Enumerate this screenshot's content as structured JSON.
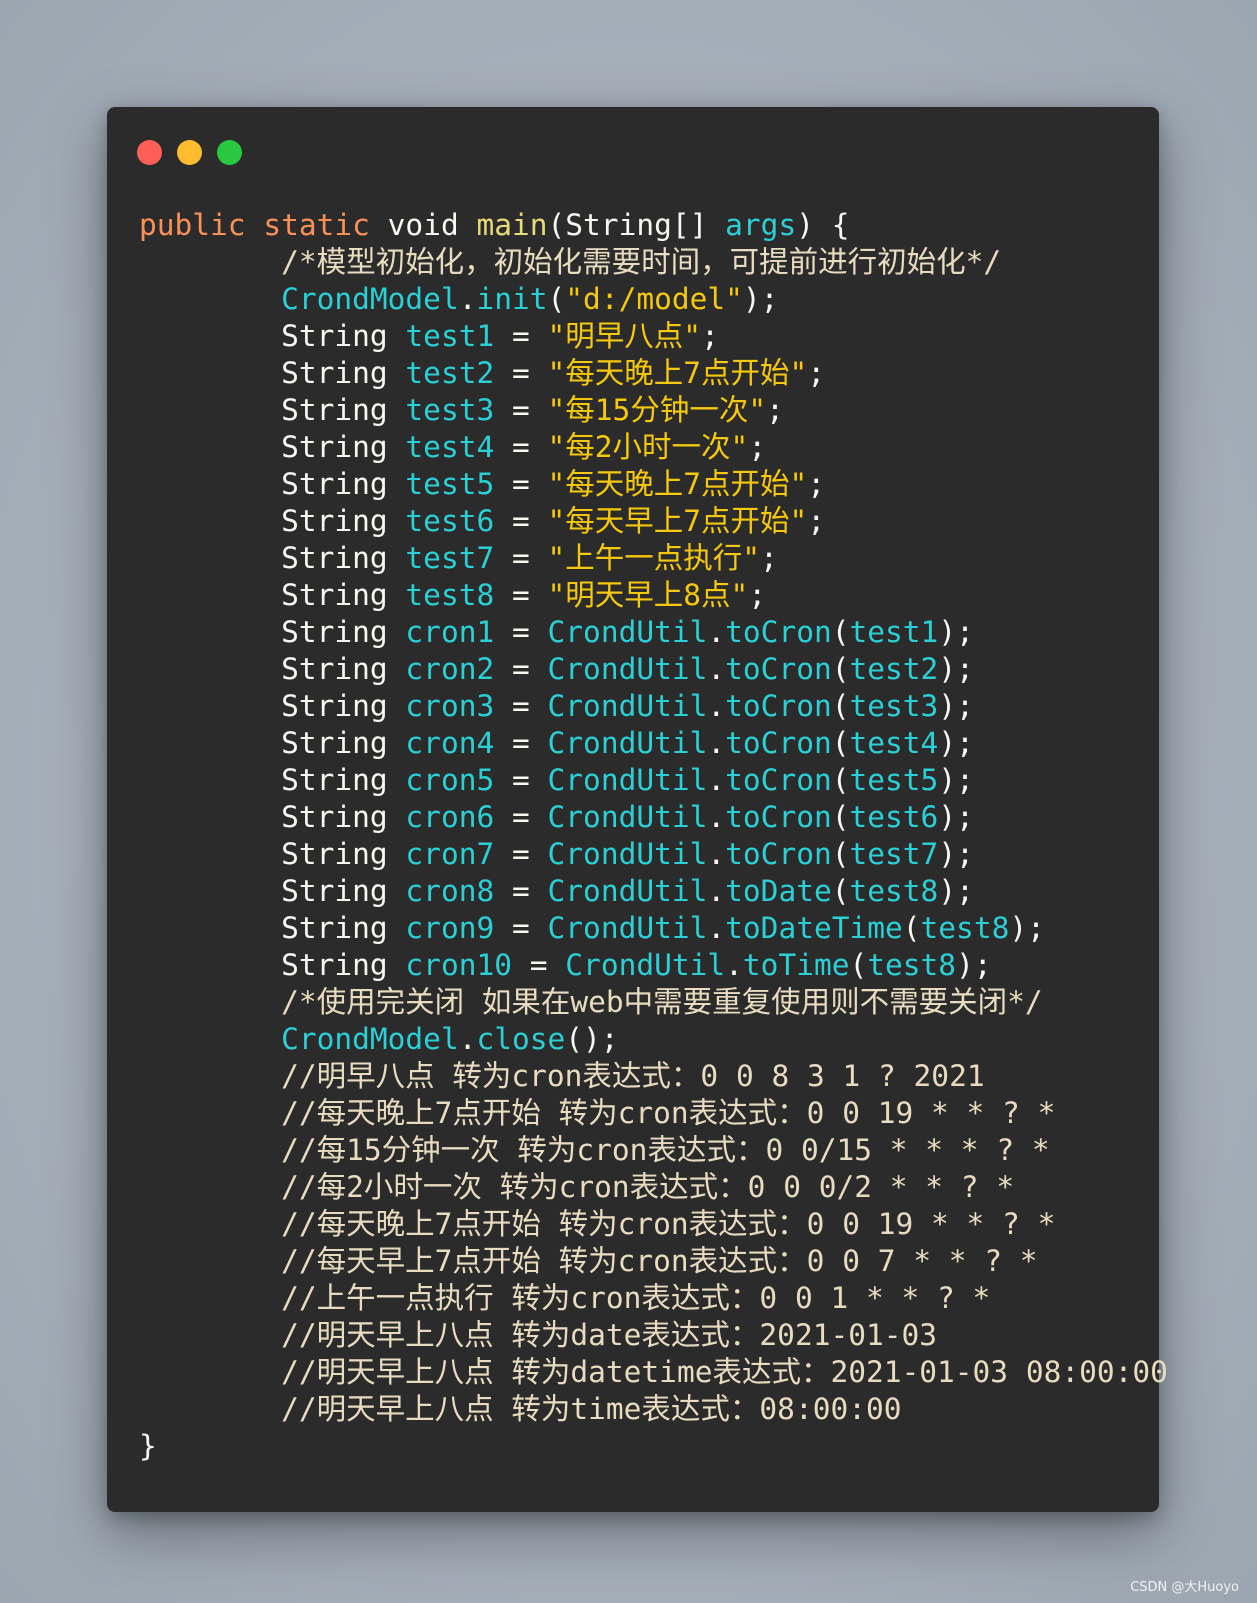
{
  "window": {
    "controls": [
      {
        "name": "close",
        "color": "#ff5f57"
      },
      {
        "name": "minimize",
        "color": "#febc2e"
      },
      {
        "name": "maximize",
        "color": "#28c840"
      }
    ]
  },
  "code_lines": [
    [
      [
        "keyword",
        "public "
      ],
      [
        "keyword",
        "static "
      ],
      [
        "default",
        "void "
      ],
      [
        "func",
        "main"
      ],
      [
        "punct",
        "("
      ],
      [
        "default",
        "String"
      ],
      [
        "punct",
        "[] "
      ],
      [
        "var",
        "args"
      ],
      [
        "punct",
        ") {"
      ]
    ],
    [
      [
        "default",
        "        "
      ],
      [
        "comment",
        "/*模型初始化，初始化需要时间，可提前进行初始化*/"
      ]
    ],
    [
      [
        "default",
        "        "
      ],
      [
        "var",
        "CrondModel"
      ],
      [
        "punct",
        "."
      ],
      [
        "var",
        "init"
      ],
      [
        "punct",
        "("
      ],
      [
        "string",
        "\"d:/model\""
      ],
      [
        "punct",
        ");"
      ]
    ],
    [
      [
        "default",
        "        String "
      ],
      [
        "var",
        "test1"
      ],
      [
        "punct",
        " = "
      ],
      [
        "string",
        "\"明早八点\""
      ],
      [
        "punct",
        ";"
      ]
    ],
    [
      [
        "default",
        "        String "
      ],
      [
        "var",
        "test2"
      ],
      [
        "punct",
        " = "
      ],
      [
        "string",
        "\"每天晚上7点开始\""
      ],
      [
        "punct",
        ";"
      ]
    ],
    [
      [
        "default",
        "        String "
      ],
      [
        "var",
        "test3"
      ],
      [
        "punct",
        " = "
      ],
      [
        "string",
        "\"每15分钟一次\""
      ],
      [
        "punct",
        ";"
      ]
    ],
    [
      [
        "default",
        "        String "
      ],
      [
        "var",
        "test4"
      ],
      [
        "punct",
        " = "
      ],
      [
        "string",
        "\"每2小时一次\""
      ],
      [
        "punct",
        ";"
      ]
    ],
    [
      [
        "default",
        "        String "
      ],
      [
        "var",
        "test5"
      ],
      [
        "punct",
        " = "
      ],
      [
        "string",
        "\"每天晚上7点开始\""
      ],
      [
        "punct",
        ";"
      ]
    ],
    [
      [
        "default",
        "        String "
      ],
      [
        "var",
        "test6"
      ],
      [
        "punct",
        " = "
      ],
      [
        "string",
        "\"每天早上7点开始\""
      ],
      [
        "punct",
        ";"
      ]
    ],
    [
      [
        "default",
        "        String "
      ],
      [
        "var",
        "test7"
      ],
      [
        "punct",
        " = "
      ],
      [
        "string",
        "\"上午一点执行\""
      ],
      [
        "punct",
        ";"
      ]
    ],
    [
      [
        "default",
        "        String "
      ],
      [
        "var",
        "test8"
      ],
      [
        "punct",
        " = "
      ],
      [
        "string",
        "\"明天早上8点\""
      ],
      [
        "punct",
        ";"
      ]
    ],
    [
      [
        "default",
        "        String "
      ],
      [
        "var",
        "cron1"
      ],
      [
        "punct",
        " = "
      ],
      [
        "var",
        "CrondUtil"
      ],
      [
        "punct",
        "."
      ],
      [
        "var",
        "toCron"
      ],
      [
        "punct",
        "("
      ],
      [
        "var",
        "test1"
      ],
      [
        "punct",
        ");"
      ]
    ],
    [
      [
        "default",
        "        String "
      ],
      [
        "var",
        "cron2"
      ],
      [
        "punct",
        " = "
      ],
      [
        "var",
        "CrondUtil"
      ],
      [
        "punct",
        "."
      ],
      [
        "var",
        "toCron"
      ],
      [
        "punct",
        "("
      ],
      [
        "var",
        "test2"
      ],
      [
        "punct",
        ");"
      ]
    ],
    [
      [
        "default",
        "        String "
      ],
      [
        "var",
        "cron3"
      ],
      [
        "punct",
        " = "
      ],
      [
        "var",
        "CrondUtil"
      ],
      [
        "punct",
        "."
      ],
      [
        "var",
        "toCron"
      ],
      [
        "punct",
        "("
      ],
      [
        "var",
        "test3"
      ],
      [
        "punct",
        ");"
      ]
    ],
    [
      [
        "default",
        "        String "
      ],
      [
        "var",
        "cron4"
      ],
      [
        "punct",
        " = "
      ],
      [
        "var",
        "CrondUtil"
      ],
      [
        "punct",
        "."
      ],
      [
        "var",
        "toCron"
      ],
      [
        "punct",
        "("
      ],
      [
        "var",
        "test4"
      ],
      [
        "punct",
        ");"
      ]
    ],
    [
      [
        "default",
        "        String "
      ],
      [
        "var",
        "cron5"
      ],
      [
        "punct",
        " = "
      ],
      [
        "var",
        "CrondUtil"
      ],
      [
        "punct",
        "."
      ],
      [
        "var",
        "toCron"
      ],
      [
        "punct",
        "("
      ],
      [
        "var",
        "test5"
      ],
      [
        "punct",
        ");"
      ]
    ],
    [
      [
        "default",
        "        String "
      ],
      [
        "var",
        "cron6"
      ],
      [
        "punct",
        " = "
      ],
      [
        "var",
        "CrondUtil"
      ],
      [
        "punct",
        "."
      ],
      [
        "var",
        "toCron"
      ],
      [
        "punct",
        "("
      ],
      [
        "var",
        "test6"
      ],
      [
        "punct",
        ");"
      ]
    ],
    [
      [
        "default",
        "        String "
      ],
      [
        "var",
        "cron7"
      ],
      [
        "punct",
        " = "
      ],
      [
        "var",
        "CrondUtil"
      ],
      [
        "punct",
        "."
      ],
      [
        "var",
        "toCron"
      ],
      [
        "punct",
        "("
      ],
      [
        "var",
        "test7"
      ],
      [
        "punct",
        ");"
      ]
    ],
    [
      [
        "default",
        "        String "
      ],
      [
        "var",
        "cron8"
      ],
      [
        "punct",
        " = "
      ],
      [
        "var",
        "CrondUtil"
      ],
      [
        "punct",
        "."
      ],
      [
        "var",
        "toDate"
      ],
      [
        "punct",
        "("
      ],
      [
        "var",
        "test8"
      ],
      [
        "punct",
        ");"
      ]
    ],
    [
      [
        "default",
        "        String "
      ],
      [
        "var",
        "cron9"
      ],
      [
        "punct",
        " = "
      ],
      [
        "var",
        "CrondUtil"
      ],
      [
        "punct",
        "."
      ],
      [
        "var",
        "toDateTime"
      ],
      [
        "punct",
        "("
      ],
      [
        "var",
        "test8"
      ],
      [
        "punct",
        ");"
      ]
    ],
    [
      [
        "default",
        "        String "
      ],
      [
        "var",
        "cron10"
      ],
      [
        "punct",
        " = "
      ],
      [
        "var",
        "CrondUtil"
      ],
      [
        "punct",
        "."
      ],
      [
        "var",
        "toTime"
      ],
      [
        "punct",
        "("
      ],
      [
        "var",
        "test8"
      ],
      [
        "punct",
        ");"
      ]
    ],
    [
      [
        "default",
        "        "
      ],
      [
        "comment",
        "/*使用完关闭 如果在web中需要重复使用则不需要关闭*/"
      ]
    ],
    [
      [
        "default",
        "        "
      ],
      [
        "var",
        "CrondModel"
      ],
      [
        "punct",
        "."
      ],
      [
        "var",
        "close"
      ],
      [
        "punct",
        "();"
      ]
    ],
    [
      [
        "default",
        "        "
      ],
      [
        "comment",
        "//明早八点 转为cron表达式：0 0 8 3 1 ? 2021"
      ]
    ],
    [
      [
        "default",
        "        "
      ],
      [
        "comment",
        "//每天晚上7点开始 转为cron表达式：0 0 19 * * ? *"
      ]
    ],
    [
      [
        "default",
        "        "
      ],
      [
        "comment",
        "//每15分钟一次 转为cron表达式：0 0/15 * * * ? *"
      ]
    ],
    [
      [
        "default",
        "        "
      ],
      [
        "comment",
        "//每2小时一次 转为cron表达式：0 0 0/2 * * ? *"
      ]
    ],
    [
      [
        "default",
        "        "
      ],
      [
        "comment",
        "//每天晚上7点开始 转为cron表达式：0 0 19 * * ? *"
      ]
    ],
    [
      [
        "default",
        "        "
      ],
      [
        "comment",
        "//每天早上7点开始 转为cron表达式：0 0 7 * * ? *"
      ]
    ],
    [
      [
        "default",
        "        "
      ],
      [
        "comment",
        "//上午一点执行 转为cron表达式：0 0 1 * * ? *"
      ]
    ],
    [
      [
        "default",
        "        "
      ],
      [
        "comment",
        "//明天早上八点 转为date表达式：2021-01-03"
      ]
    ],
    [
      [
        "default",
        "        "
      ],
      [
        "comment",
        "//明天早上八点 转为datetime表达式：2021-01-03 08:00:00"
      ]
    ],
    [
      [
        "default",
        "        "
      ],
      [
        "comment",
        "//明天早上八点 转为time表达式：08:00:00"
      ]
    ],
    [
      [
        "punct",
        "}"
      ]
    ]
  ],
  "watermark": "CSDN @大Huoyo"
}
